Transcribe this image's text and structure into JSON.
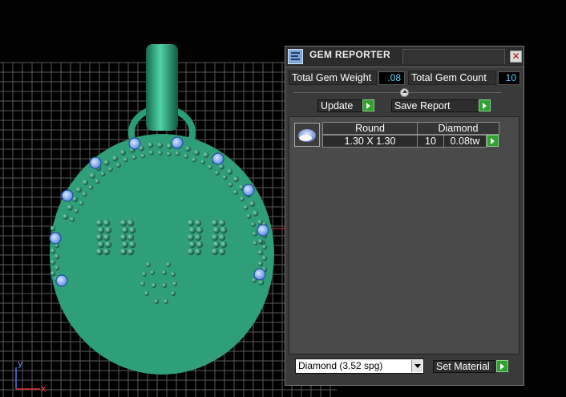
{
  "viewport": {
    "axis_y_label": "y",
    "axis_x_label": "x",
    "colors": {
      "background": "#000000",
      "grid": "#5a5a5a",
      "metal": "#2f9f7a",
      "gem_blue": "#6fa0ff",
      "axis_x": "#e03030",
      "axis_y": "#4080ff"
    }
  },
  "gem_reporter": {
    "title": "GEM REPORTER",
    "close_icon": "close-x-icon",
    "total_gem_weight_label": "Total Gem Weight",
    "total_gem_weight_value": ".08",
    "total_gem_count_label": "Total Gem Count",
    "total_gem_count_value": "10",
    "update_label": "Update",
    "save_report_label": "Save Report",
    "table": {
      "headers": {
        "shape": "Round",
        "material": "Diamond"
      },
      "row": {
        "size": "1.30 X 1.30",
        "count": "10",
        "weight": "0.08tw"
      },
      "thumb_icon": "gem-thumbnail-icon"
    },
    "material_select": {
      "value": "Diamond    (3.52 spg)"
    },
    "set_material_label": "Set Material"
  }
}
